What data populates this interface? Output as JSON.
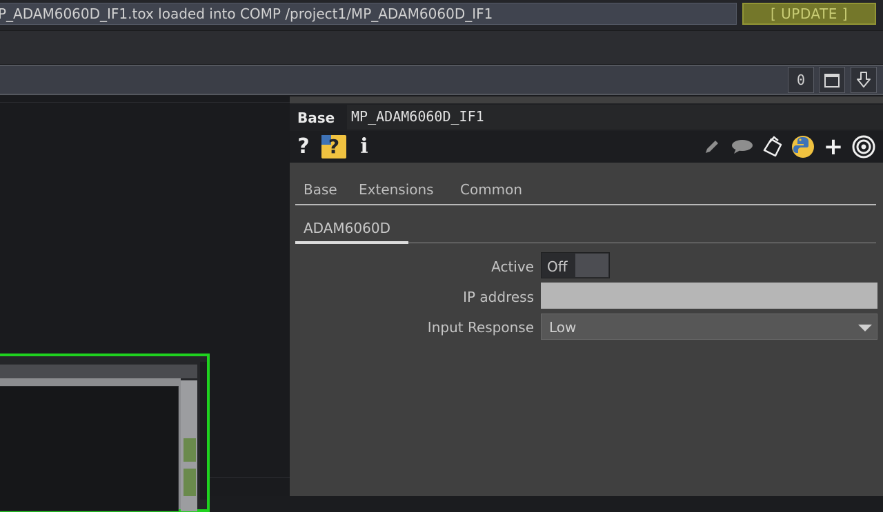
{
  "status_bar": {
    "message": "P_ADAM6060D_IF1.tox loaded into COMP /project1/MP_ADAM6060D_IF1",
    "update_label": "[ UPDATE ]"
  },
  "toolbar": {
    "zero_label": "0",
    "window_icon": "window-icon",
    "download_icon": "down-arrow-icon"
  },
  "panel": {
    "op_type": "Base",
    "op_name": "MP_ADAM6060D_IF1",
    "icons": {
      "help": "?",
      "help_python": "?",
      "info": "i",
      "add": "+"
    },
    "tabs": [
      {
        "label": "Base"
      },
      {
        "label": "Extensions"
      },
      {
        "label": "Common"
      }
    ],
    "page_tab": "ADAM6060D",
    "params": {
      "active": {
        "label": "Active",
        "value": "Off"
      },
      "ip_address": {
        "label": "IP address",
        "value": ""
      },
      "input_response": {
        "label": "Input Response",
        "value": "Low"
      }
    }
  },
  "colors": {
    "update_button": "#74772a",
    "node_outline": "#1fd21f",
    "python_yellow": "#f0c240",
    "python_blue": "#3f73b6"
  }
}
